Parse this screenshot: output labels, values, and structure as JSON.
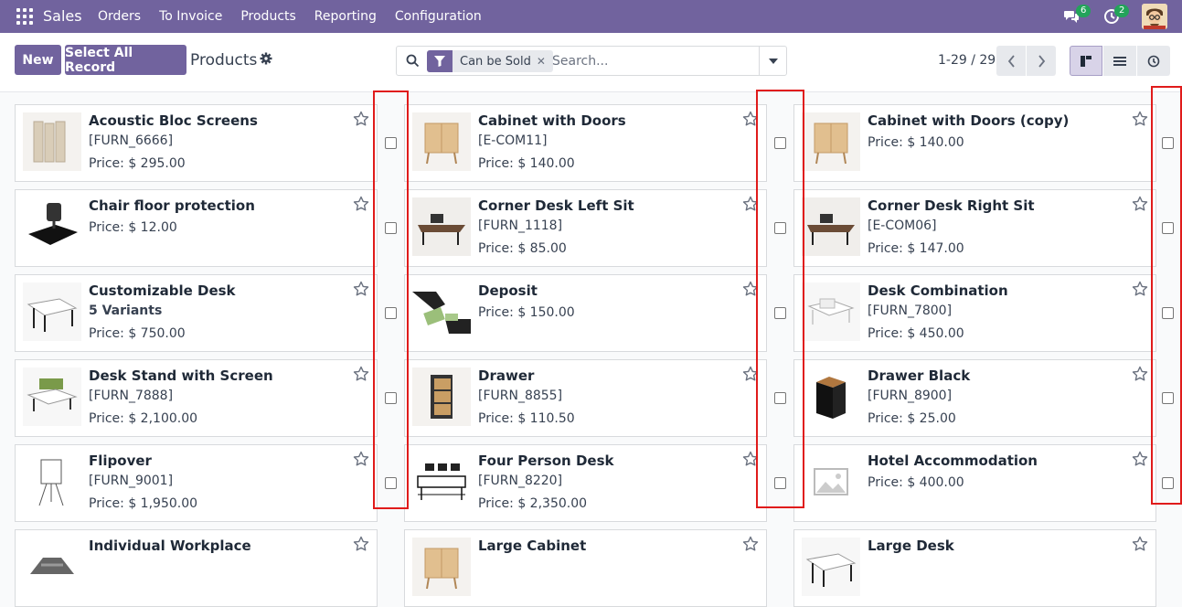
{
  "navbar": {
    "app_name": "Sales",
    "menu": [
      "Orders",
      "To Invoice",
      "Products",
      "Reporting",
      "Configuration"
    ],
    "messages_count": "6",
    "activities_count": "2"
  },
  "control": {
    "new_label": "New",
    "select_all_label": "Select All Record",
    "title": "Products",
    "filter_label": "Can be Sold",
    "search_placeholder": "Search...",
    "pager": "1-29 / 29"
  },
  "colors": {
    "brand": "#71639e",
    "highlight_box": "#e01b1b"
  },
  "products": [
    {
      "name": "Acoustic Bloc Screens",
      "ref": "[FURN_6666]",
      "price": "Price: $ 295.00",
      "icon": "acoustic-screen"
    },
    {
      "name": "Cabinet with Doors",
      "ref": "[E-COM11]",
      "price": "Price: $ 140.00",
      "icon": "cabinet"
    },
    {
      "name": "Cabinet with Doors (copy)",
      "ref": "",
      "price": "Price: $ 140.00",
      "icon": "cabinet"
    },
    {
      "name": "Chair floor protection",
      "ref": "",
      "price": "Price: $ 12.00",
      "icon": "floor-mat"
    },
    {
      "name": "Corner Desk Left Sit",
      "ref": "[FURN_1118]",
      "price": "Price: $ 85.00",
      "icon": "corner-desk"
    },
    {
      "name": "Corner Desk Right Sit",
      "ref": "[E-COM06]",
      "price": "Price: $ 147.00",
      "icon": "corner-desk"
    },
    {
      "name": "Customizable Desk",
      "ref": "5 Variants",
      "price": "Price: $ 750.00",
      "icon": "desk"
    },
    {
      "name": "Deposit",
      "ref": "",
      "price": "Price: $ 150.00",
      "icon": "money"
    },
    {
      "name": "Desk Combination",
      "ref": "[FURN_7800]",
      "price": "Price: $ 450.00",
      "icon": "desk-combination"
    },
    {
      "name": "Desk Stand with Screen",
      "ref": "[FURN_7888]",
      "price": "Price: $ 2,100.00",
      "icon": "desk-stand"
    },
    {
      "name": "Drawer",
      "ref": "[FURN_8855]",
      "price": "Price: $ 110.50",
      "icon": "drawer"
    },
    {
      "name": "Drawer Black",
      "ref": "[FURN_8900]",
      "price": "Price: $ 25.00",
      "icon": "drawer-black"
    },
    {
      "name": "Flipover",
      "ref": "[FURN_9001]",
      "price": "Price: $ 1,950.00",
      "icon": "flipover"
    },
    {
      "name": "Four Person Desk",
      "ref": "[FURN_8220]",
      "price": "Price: $ 2,350.00",
      "icon": "four-person-desk"
    },
    {
      "name": "Hotel Accommodation",
      "ref": "",
      "price": "Price: $ 400.00",
      "icon": "image-placeholder"
    },
    {
      "name": "Individual Workplace",
      "ref": "",
      "price": "",
      "icon": "workplace"
    },
    {
      "name": "Large Cabinet",
      "ref": "",
      "price": "",
      "icon": "cabinet"
    },
    {
      "name": "Large Desk",
      "ref": "",
      "price": "",
      "icon": "desk"
    }
  ]
}
